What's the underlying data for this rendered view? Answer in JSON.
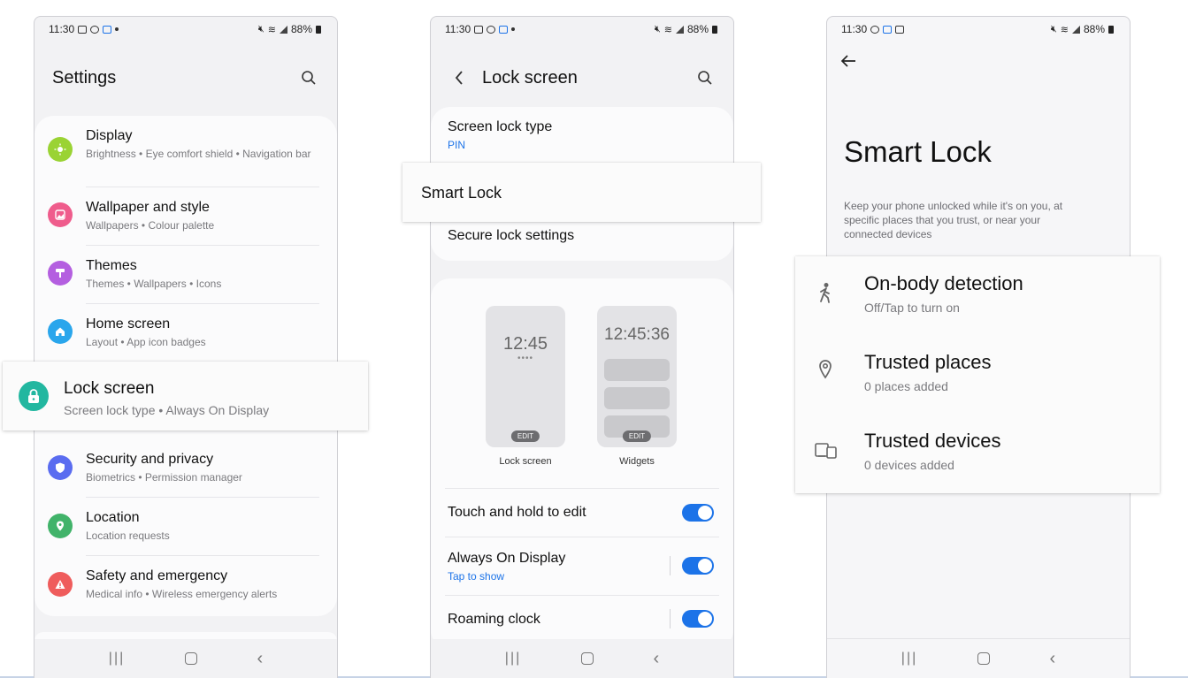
{
  "status": {
    "time": "11:30",
    "battery": "88%"
  },
  "settings": {
    "title": "Settings",
    "items": [
      {
        "title": "Display",
        "subtitle": "Brightness  •  Eye comfort shield  •  Navigation bar",
        "color": "#9ad334"
      },
      {
        "title": "Wallpaper and style",
        "subtitle": "Wallpapers  •  Colour palette",
        "color": "#ef5c8c"
      },
      {
        "title": "Themes",
        "subtitle": "Themes  •  Wallpapers  •  Icons",
        "color": "#b45fe0"
      },
      {
        "title": "Home screen",
        "subtitle": "Layout  •  App icon badges",
        "color": "#2aa6ec"
      },
      {
        "title": "Lock screen",
        "subtitle": "Screen lock type  •  Always On Display",
        "color": "#22b7a0"
      },
      {
        "title": "Security and privacy",
        "subtitle": "Biometrics  •  Permission manager",
        "color": "#5a6cf0"
      },
      {
        "title": "Location",
        "subtitle": "Location requests",
        "color": "#41b36a"
      },
      {
        "title": "Safety and emergency",
        "subtitle": "Medical info  •  Wireless emergency alerts",
        "color": "#ef5c5c"
      }
    ]
  },
  "lockscreen": {
    "title": "Lock screen",
    "screen_lock_type": "Screen lock type",
    "screen_lock_value": "PIN",
    "smart_lock": "Smart Lock",
    "secure_lock": "Secure lock settings",
    "preview_lock_time": "12:45",
    "preview_lock_dots": "••••",
    "preview_widgets_time": "12:45:36",
    "edit_label": "EDIT",
    "preview_lock_label": "Lock screen",
    "preview_widgets_label": "Widgets",
    "touch_hold": "Touch and hold to edit",
    "aod": "Always On Display",
    "aod_sub": "Tap to show",
    "roaming": "Roaming clock",
    "accent": "#1c73e8"
  },
  "smartlock": {
    "title": "Smart Lock",
    "description": "Keep your phone unlocked while it's on you, at specific places that you trust, or near your connected devices",
    "items": [
      {
        "title": "On-body detection",
        "subtitle": "Off/Tap to turn on"
      },
      {
        "title": "Trusted places",
        "subtitle": "0 places added"
      },
      {
        "title": "Trusted devices",
        "subtitle": "0 devices added"
      }
    ]
  }
}
